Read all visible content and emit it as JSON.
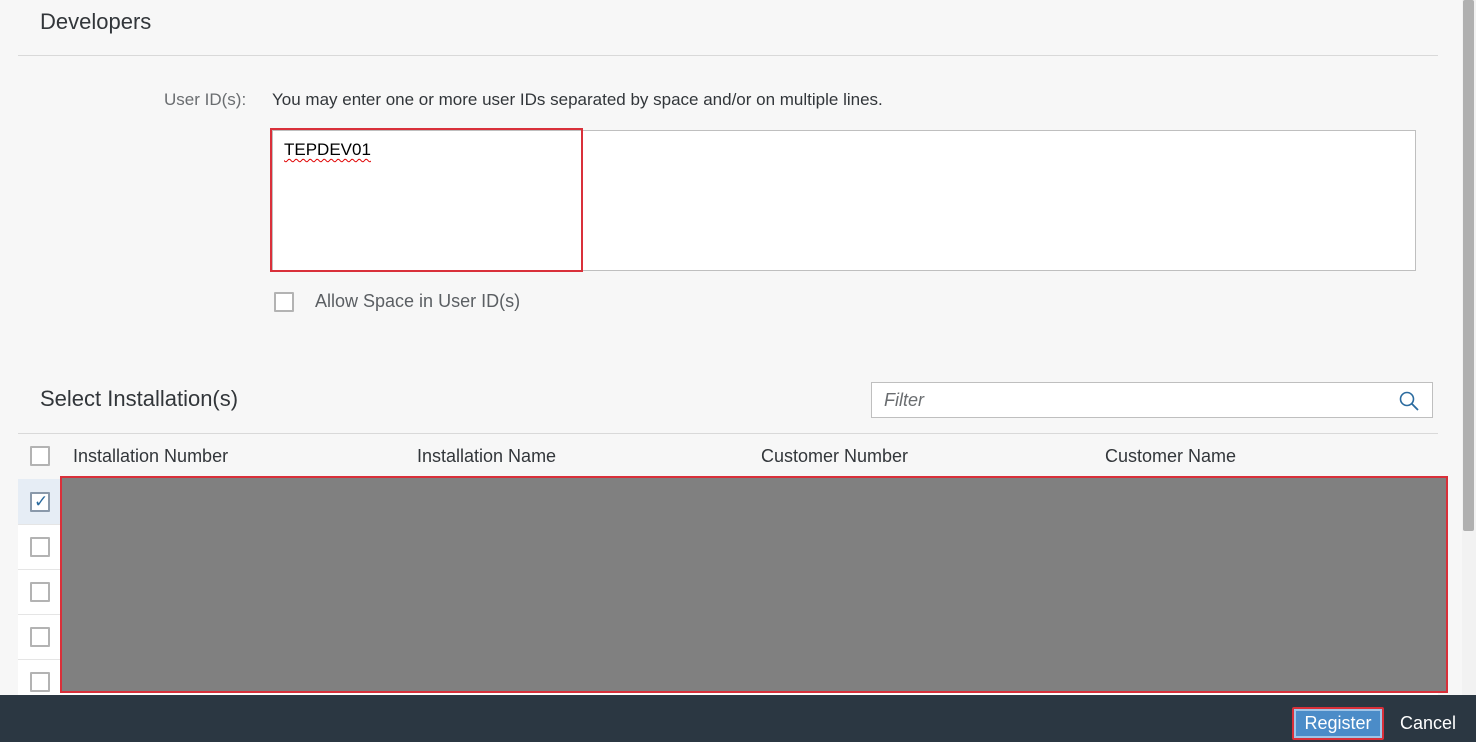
{
  "developers": {
    "title": "Developers",
    "user_ids_label": "User ID(s):",
    "user_ids_hint": "You may enter one or more user IDs separated by space and/or on multiple lines.",
    "user_ids_value": "TEPDEV01",
    "allow_space_label": "Allow Space in User ID(s)",
    "allow_space_checked": false
  },
  "installations": {
    "title": "Select Installation(s)",
    "filter_placeholder": "Filter",
    "columns": [
      "Installation Number",
      "Installation Name",
      "Customer Number",
      "Customer Name"
    ],
    "rows": [
      {
        "selected": true
      },
      {
        "selected": false
      },
      {
        "selected": false
      },
      {
        "selected": false
      },
      {
        "selected": false
      }
    ]
  },
  "footer": {
    "register_label": "Register",
    "cancel_label": "Cancel"
  },
  "icons": {
    "filter_search": "search-icon",
    "checkmark": "checkmark-icon"
  },
  "colors": {
    "footer_bg": "#2b3742",
    "primary_button": "#4b8cc8",
    "highlight_red": "#d9303a",
    "redacted_gray": "#808080"
  }
}
